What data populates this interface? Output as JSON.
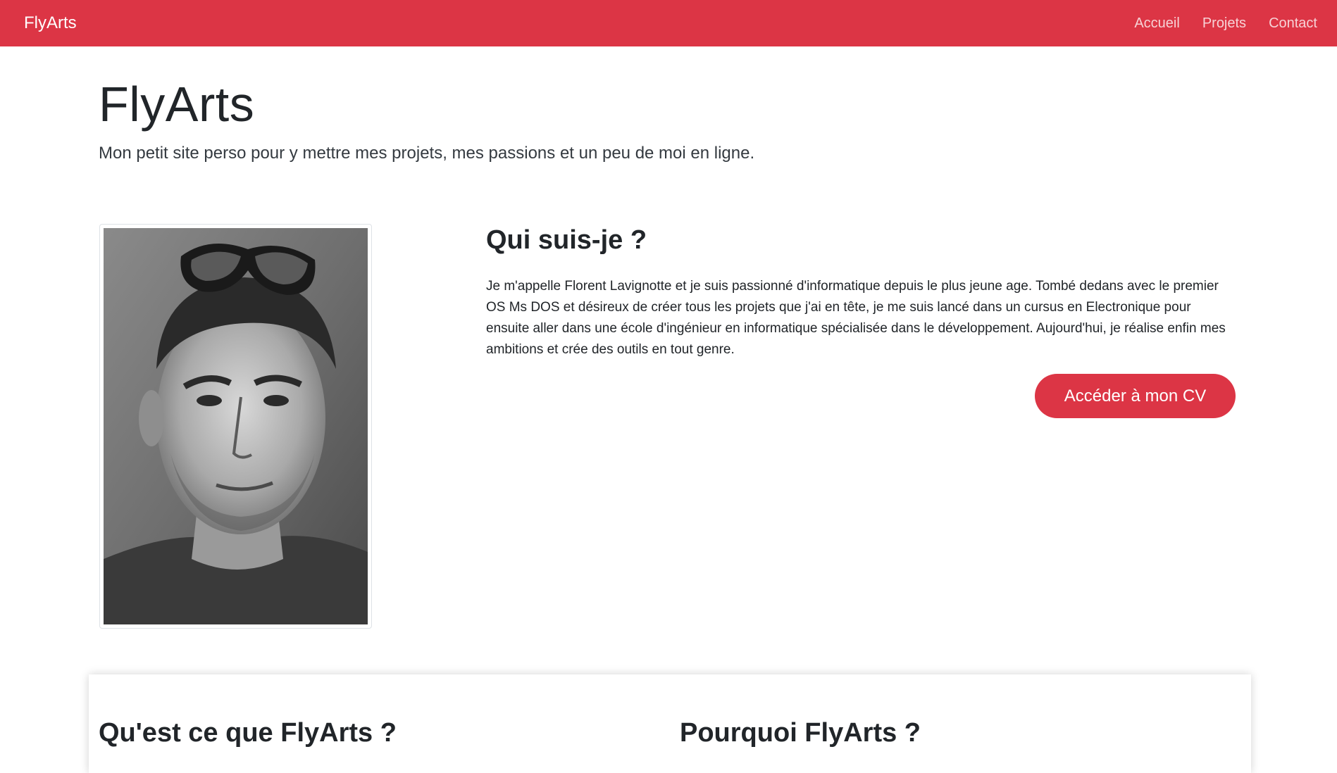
{
  "navbar": {
    "brand": "FlyArts",
    "links": [
      "Accueil",
      "Projets",
      "Contact"
    ],
    "color": "#dc3545"
  },
  "hero": {
    "title": "FlyArts",
    "lead": "Mon petit site perso pour y mettre mes projets, mes passions et un peu de moi en ligne."
  },
  "about": {
    "photo_alt": "portrait",
    "title": "Qui suis-je ?",
    "text": "Je m'appelle Florent Lavignotte et je suis passionné d'informatique depuis le plus jeune age. Tombé dedans avec le premier OS Ms DOS et désireux de créer tous les projets que j'ai en tête, je me suis lancé dans un cursus en Electronique pour ensuite aller dans une école d'ingénieur en informatique spécialisée dans le développement. Aujourd'hui, je réalise enfin mes ambitions et crée des outils en tout genre.",
    "cv_button": "Accéder à mon CV"
  },
  "card": {
    "heading_left": "Qu'est ce que FlyArts ?",
    "heading_right": "Pourquoi FlyArts ?"
  }
}
